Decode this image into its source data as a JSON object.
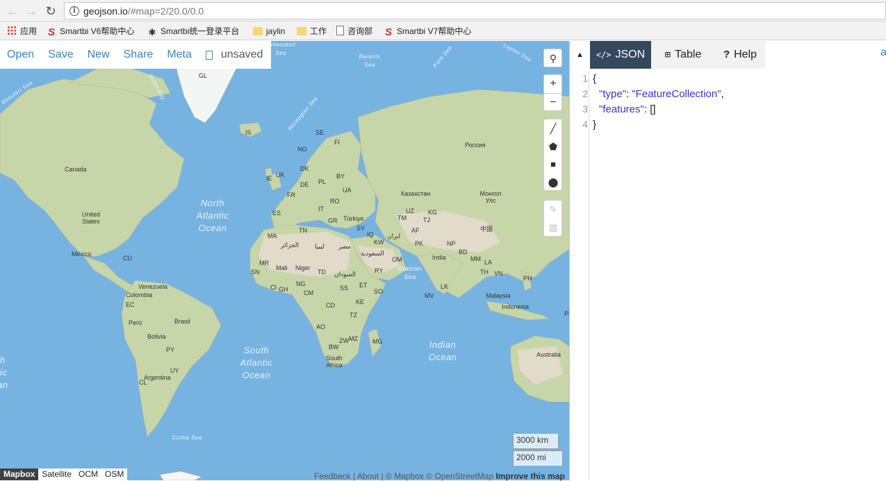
{
  "browser": {
    "url_host": "geojson.io",
    "url_rest": "/#map=2/20.0/0.0",
    "back_icon": "arrow-left-icon",
    "forward_icon": "arrow-right-icon",
    "reload_icon": "reload-icon",
    "info_icon": "info-icon"
  },
  "bookmarks": [
    {
      "label": "应用",
      "icon": "apps-grid-icon"
    },
    {
      "label": "Smartbi V6帮助中心",
      "icon": "smartbi-icon"
    },
    {
      "label": "Smartbi统一登录平台",
      "icon": "smartbi-person-icon"
    },
    {
      "label": "jaylin",
      "icon": "folder-icon"
    },
    {
      "label": "工作",
      "icon": "folder-icon"
    },
    {
      "label": "咨询部",
      "icon": "document-icon"
    },
    {
      "label": "Smartbi V7帮助中心",
      "icon": "smartbi-icon"
    }
  ],
  "toolbar": {
    "open": "Open",
    "save": "Save",
    "new": "New",
    "share": "Share",
    "meta": "Meta",
    "unsaved": "unsaved"
  },
  "map": {
    "labels": [
      {
        "t": "GL"
      },
      {
        "t": "IS"
      },
      {
        "t": "SE"
      },
      {
        "t": "FI"
      },
      {
        "t": "NO"
      },
      {
        "t": "DK"
      },
      {
        "t": "IE"
      },
      {
        "t": "UK"
      },
      {
        "t": "DE"
      },
      {
        "t": "PL"
      },
      {
        "t": "BY"
      },
      {
        "t": "UA"
      },
      {
        "t": "FR"
      },
      {
        "t": "IT"
      },
      {
        "t": "RO"
      },
      {
        "t": "ES"
      },
      {
        "t": "GR"
      },
      {
        "t": "Türkiye"
      },
      {
        "t": "SY"
      },
      {
        "t": "IQ"
      },
      {
        "t": "KW"
      },
      {
        "t": "ایران"
      },
      {
        "t": "TN"
      },
      {
        "t": "MA"
      },
      {
        "t": "الجزائر"
      },
      {
        "t": "ليبيا"
      },
      {
        "t": "مصر"
      },
      {
        "t": "السعودية"
      },
      {
        "t": "OM"
      },
      {
        "t": "RY"
      },
      {
        "t": "MR"
      },
      {
        "t": "Mali"
      },
      {
        "t": "Niger"
      },
      {
        "t": "TD"
      },
      {
        "t": "السودان"
      },
      {
        "t": "SN"
      },
      {
        "t": "CI"
      },
      {
        "t": "GH"
      },
      {
        "t": "NG"
      },
      {
        "t": "CM"
      },
      {
        "t": "SS"
      },
      {
        "t": "ET"
      },
      {
        "t": "SO"
      },
      {
        "t": "CD"
      },
      {
        "t": "KE"
      },
      {
        "t": "TZ"
      },
      {
        "t": "AO"
      },
      {
        "t": "ZW"
      },
      {
        "t": "MZ"
      },
      {
        "t": "BW"
      },
      {
        "t": "MG"
      },
      {
        "t": "South Africa"
      },
      {
        "t": "Россия"
      },
      {
        "t": "Казахстан"
      },
      {
        "t": "UZ"
      },
      {
        "t": "KG"
      },
      {
        "t": "TM"
      },
      {
        "t": "TJ"
      },
      {
        "t": "AF"
      },
      {
        "t": "PK"
      },
      {
        "t": "NP"
      },
      {
        "t": "India"
      },
      {
        "t": "BD"
      },
      {
        "t": "LK"
      },
      {
        "t": "MV"
      },
      {
        "t": "Монгол Улс"
      },
      {
        "t": "中国"
      },
      {
        "t": "MM"
      },
      {
        "t": "LA"
      },
      {
        "t": "TH"
      },
      {
        "t": "VN"
      },
      {
        "t": "PH"
      },
      {
        "t": "Malaysia"
      },
      {
        "t": "Indonesia"
      },
      {
        "t": "Australia"
      },
      {
        "t": "Canada"
      },
      {
        "t": "United States"
      },
      {
        "t": "México"
      },
      {
        "t": "CU"
      },
      {
        "t": "Venezuela"
      },
      {
        "t": "Colombia"
      },
      {
        "t": "EC"
      },
      {
        "t": "Perú"
      },
      {
        "t": "Brasil"
      },
      {
        "t": "Bolivia"
      },
      {
        "t": "PY"
      },
      {
        "t": "UY"
      },
      {
        "t": "Argentina"
      },
      {
        "t": "CL"
      },
      {
        "t": "PE"
      }
    ],
    "seas": [
      {
        "t": "North Atlantic Ocean"
      },
      {
        "t": "South Atlantic Ocean"
      },
      {
        "t": "Indian Ocean"
      },
      {
        "t": "Arabian Sea"
      },
      {
        "t": "Norwegian Sea"
      },
      {
        "t": "Barents Sea"
      },
      {
        "t": "Kara Sea"
      },
      {
        "t": "Laptev Sea"
      },
      {
        "t": "Greenland Sea"
      },
      {
        "t": "Baffin Bay"
      },
      {
        "t": "Beaufort Sea"
      },
      {
        "t": "Scotia Sea"
      },
      {
        "t": "th fic an"
      }
    ],
    "scale_km": "3000 km",
    "scale_mi": "2000 mi",
    "layers": [
      "Mapbox",
      "Satellite",
      "OCM",
      "OSM"
    ],
    "attribution": {
      "feedback": "Feedback",
      "about": "About",
      "mapbox": "© Mapbox",
      "osm": "© OpenStreetMap",
      "improve": "Improve this map",
      "sep": "|"
    }
  },
  "controls": {
    "zoom_in": "+",
    "zoom_out": "−"
  },
  "panel": {
    "collapse": "▲",
    "tabs": [
      {
        "label": "JSON",
        "glyph": "</>"
      },
      {
        "label": "Table",
        "glyph": "⊞"
      },
      {
        "label": "Help",
        "glyph": "?"
      }
    ],
    "right_link": "a",
    "lines": [
      "1",
      "2",
      "3",
      "4"
    ],
    "code": {
      "open_brace": "{",
      "type_key": "\"type\"",
      "type_val": "\"FeatureCollection\"",
      "features_key": "\"features\"",
      "features_val": "[]",
      "close_brace": "}"
    }
  }
}
